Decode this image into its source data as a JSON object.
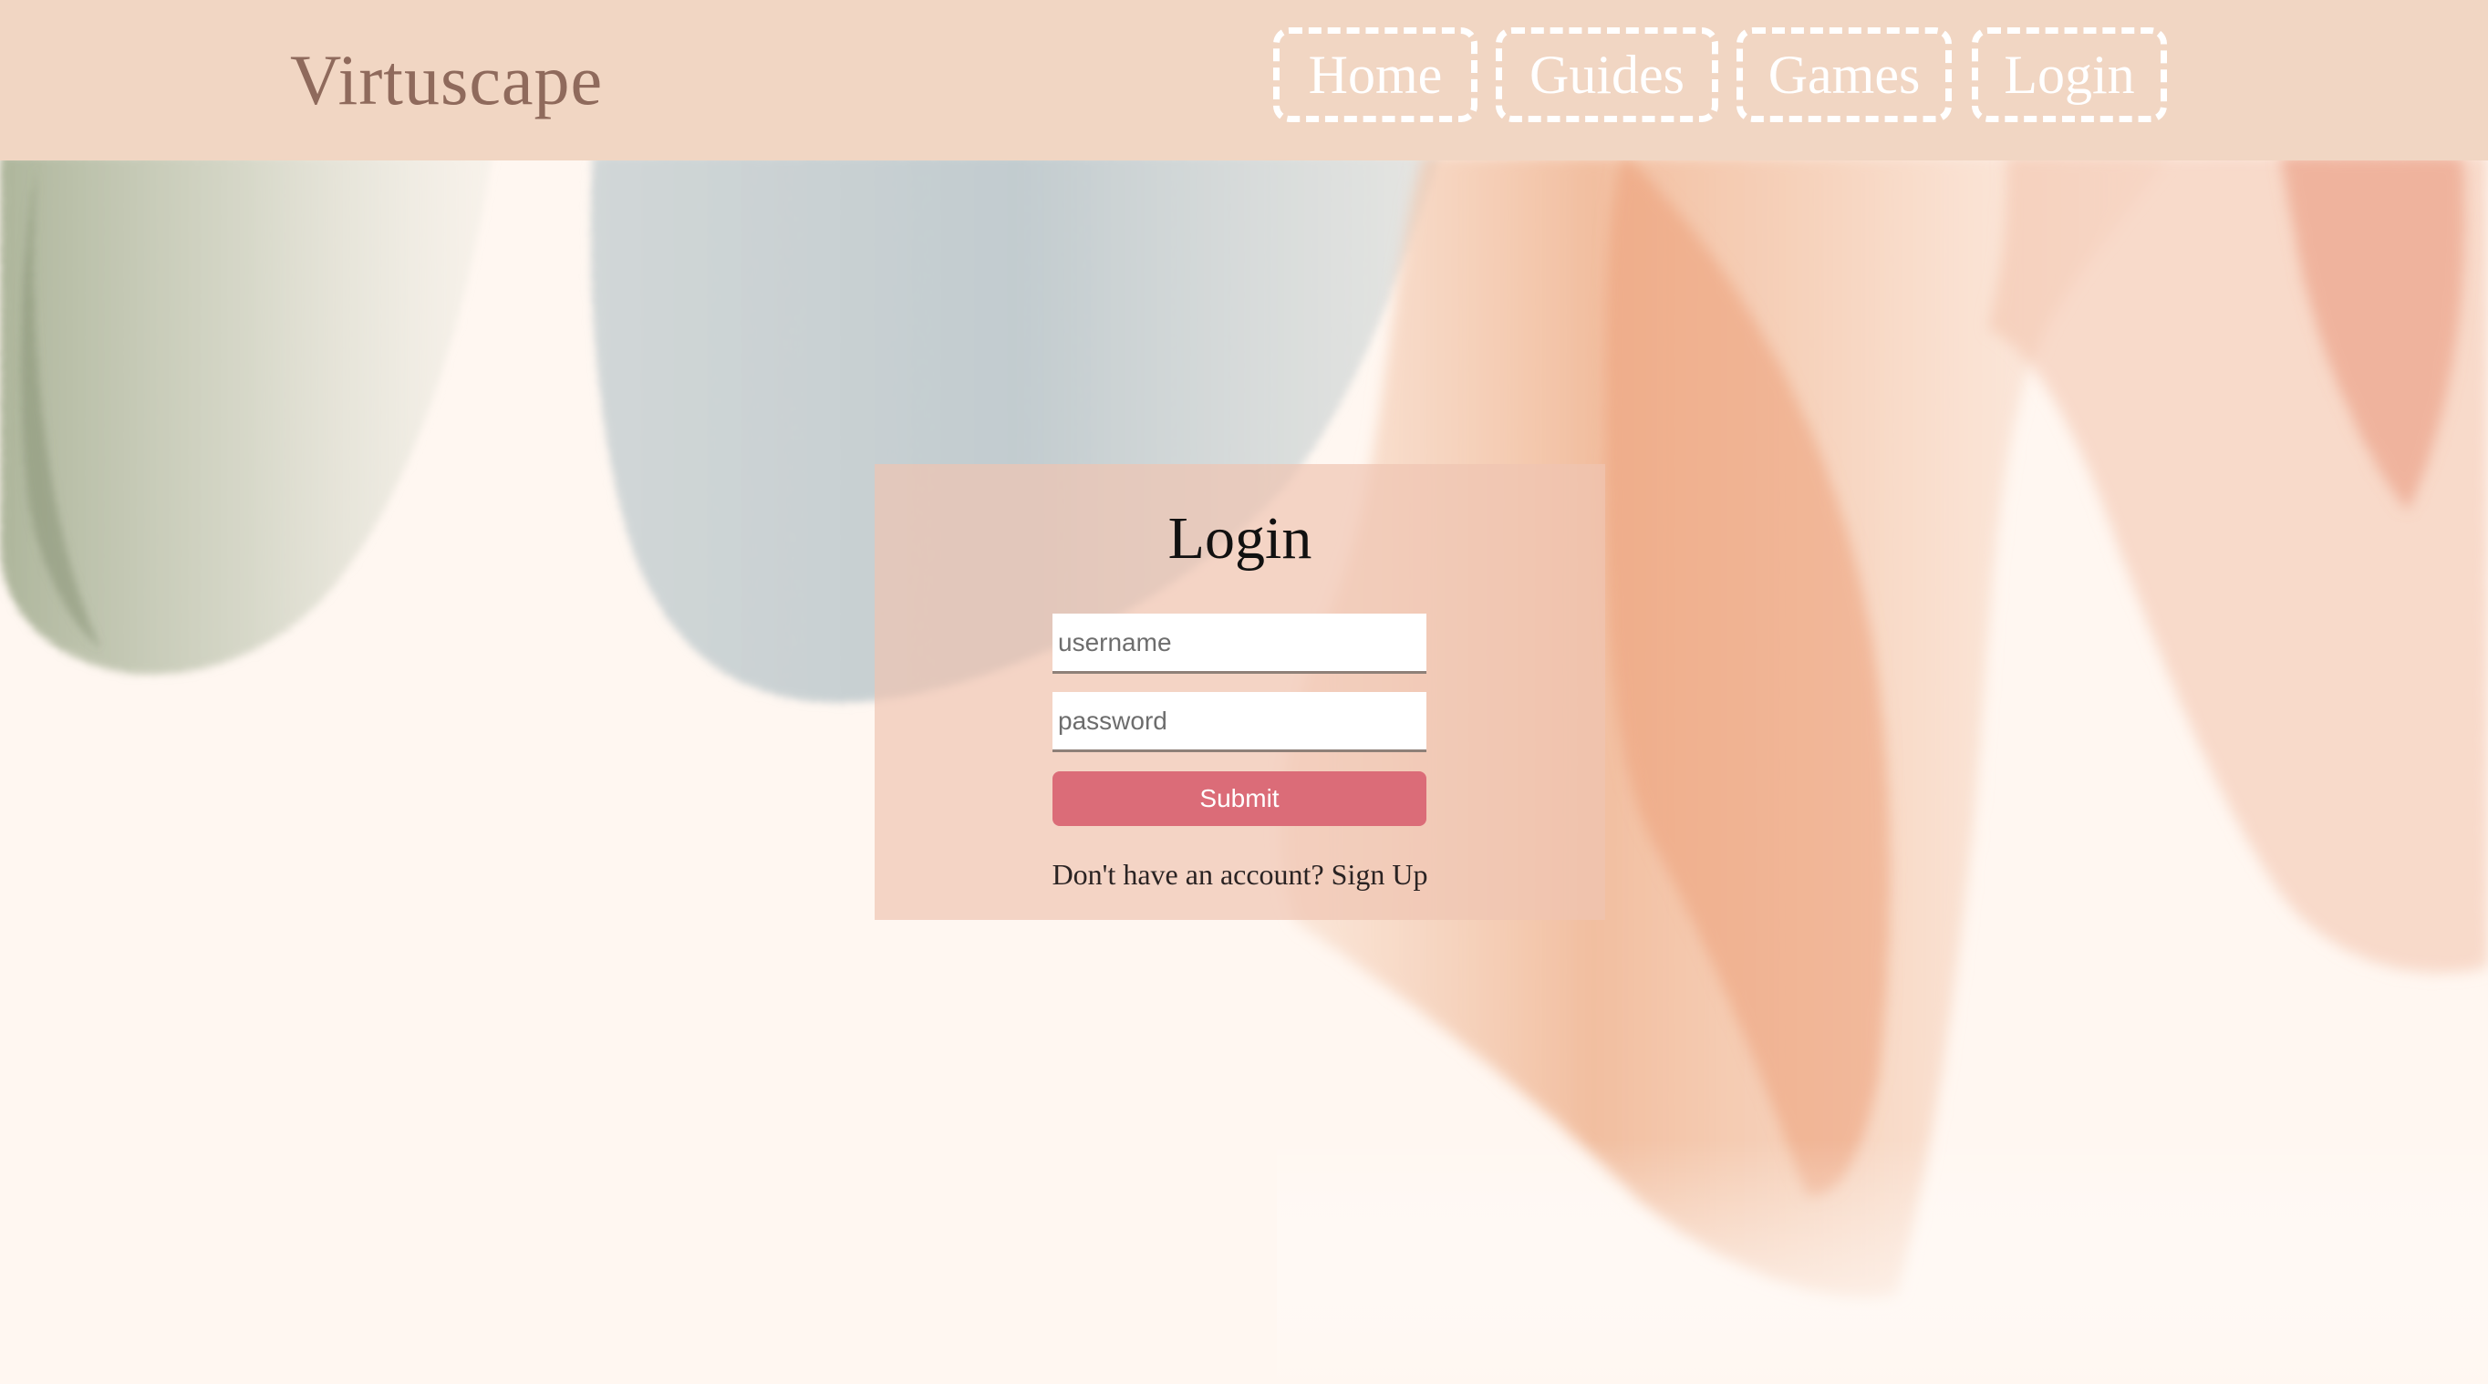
{
  "header": {
    "logo": "Virtuscape",
    "nav": [
      {
        "label": "Home"
      },
      {
        "label": "Guides"
      },
      {
        "label": "Games"
      },
      {
        "label": "Login"
      }
    ]
  },
  "login_card": {
    "title": "Login",
    "username_placeholder": "username",
    "password_placeholder": "password",
    "submit_label": "Submit",
    "signup_prompt": "Don't have an account?",
    "signup_link": "Sign Up"
  },
  "colors": {
    "header_bg": "#f1d6c3",
    "page_bg": "#fff7f1",
    "card_bg": "#f0c4b2",
    "submit_bg": "#db6c78",
    "logo": "#8f6a5c"
  }
}
